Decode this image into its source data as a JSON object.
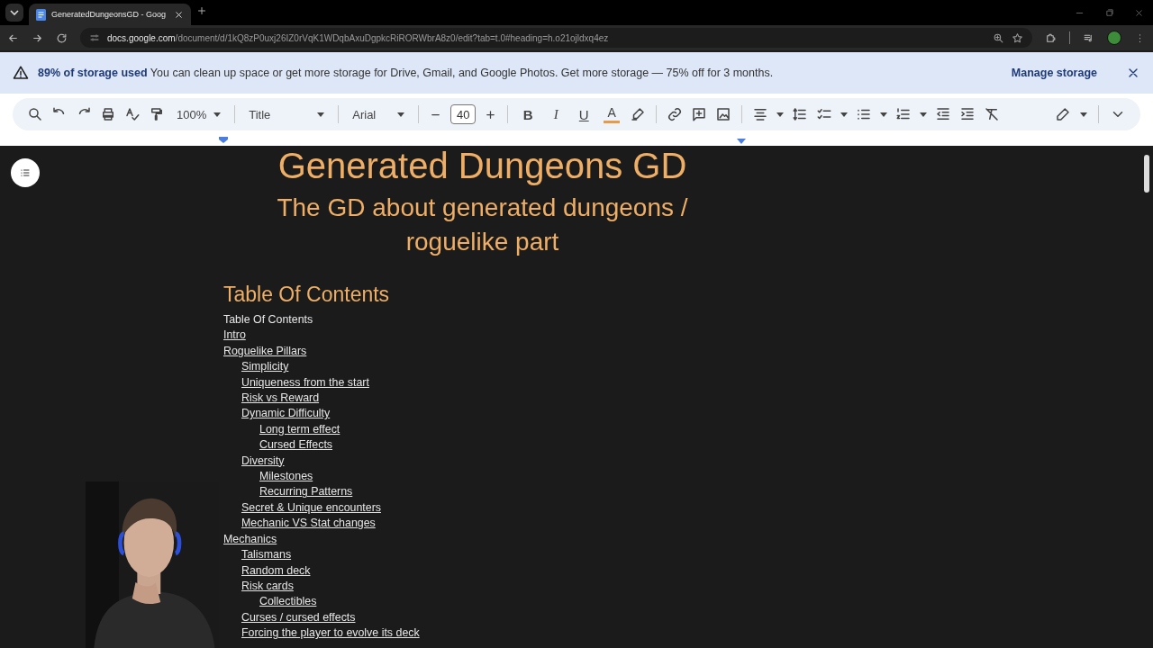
{
  "browser": {
    "tab": {
      "title": "GeneratedDungeonsGD - Goog",
      "selected": true
    },
    "url_host": "docs.google.com",
    "url_path": "/document/d/1kQ8zP0uxj26IZ0rVqK1WDqbAxuDgpkcRiRORWbrA8z0/edit?tab=t.0#heading=h.o21ojldxq4ez"
  },
  "banner": {
    "message": "**89% of storage used** You can clean up space or get more storage for Drive, Gmail, and Google Photos. Get more storage — 75% off for 3 months.",
    "action": "Manage storage"
  },
  "toolbar": {
    "zoom": "100%",
    "style": "Title",
    "font": "Arial",
    "font_size": "40",
    "format": [
      {
        "label": "B",
        "kind": "bold"
      },
      {
        "label": "I",
        "kind": "italic"
      },
      {
        "label": "U",
        "kind": "underline"
      }
    ],
    "text_color_label": "A"
  },
  "document": {
    "title": "Generated Dungeons GD",
    "subtitle": "The GD about generated dungeons / roguelike part",
    "toc_heading": "Table Of Contents",
    "toc": [
      {
        "label": "Table Of Contents",
        "linked": false
      },
      {
        "label": "Intro",
        "linked": true
      },
      {
        "label": "Roguelike Pillars",
        "linked": true,
        "children": [
          {
            "label": "Simplicity",
            "linked": true
          },
          {
            "label": "Uniqueness from the start",
            "linked": true
          },
          {
            "label": "Risk vs Reward",
            "linked": true
          },
          {
            "label": "Dynamic Difficulty",
            "linked": true,
            "children": [
              {
                "label": "Long term effect",
                "linked": true
              },
              {
                "label": "Cursed Effects",
                "linked": true
              }
            ]
          },
          {
            "label": "Diversity",
            "linked": true,
            "children": [
              {
                "label": "Milestones",
                "linked": true
              },
              {
                "label": "Recurring Patterns",
                "linked": true
              }
            ]
          },
          {
            "label": "Secret & Unique encounters",
            "linked": true
          },
          {
            "label": "Mechanic VS Stat changes",
            "linked": true
          }
        ]
      },
      {
        "label": "Mechanics",
        "linked": true,
        "children": [
          {
            "label": "Talismans",
            "linked": true
          },
          {
            "label": "Random deck",
            "linked": true
          },
          {
            "label": "Risk cards",
            "linked": true,
            "children": [
              {
                "label": "Collectibles",
                "linked": true
              }
            ]
          },
          {
            "label": "Curses / cursed effects",
            "linked": true
          },
          {
            "label": "Forcing the player to evolve its deck",
            "linked": true
          }
        ]
      }
    ]
  }
}
